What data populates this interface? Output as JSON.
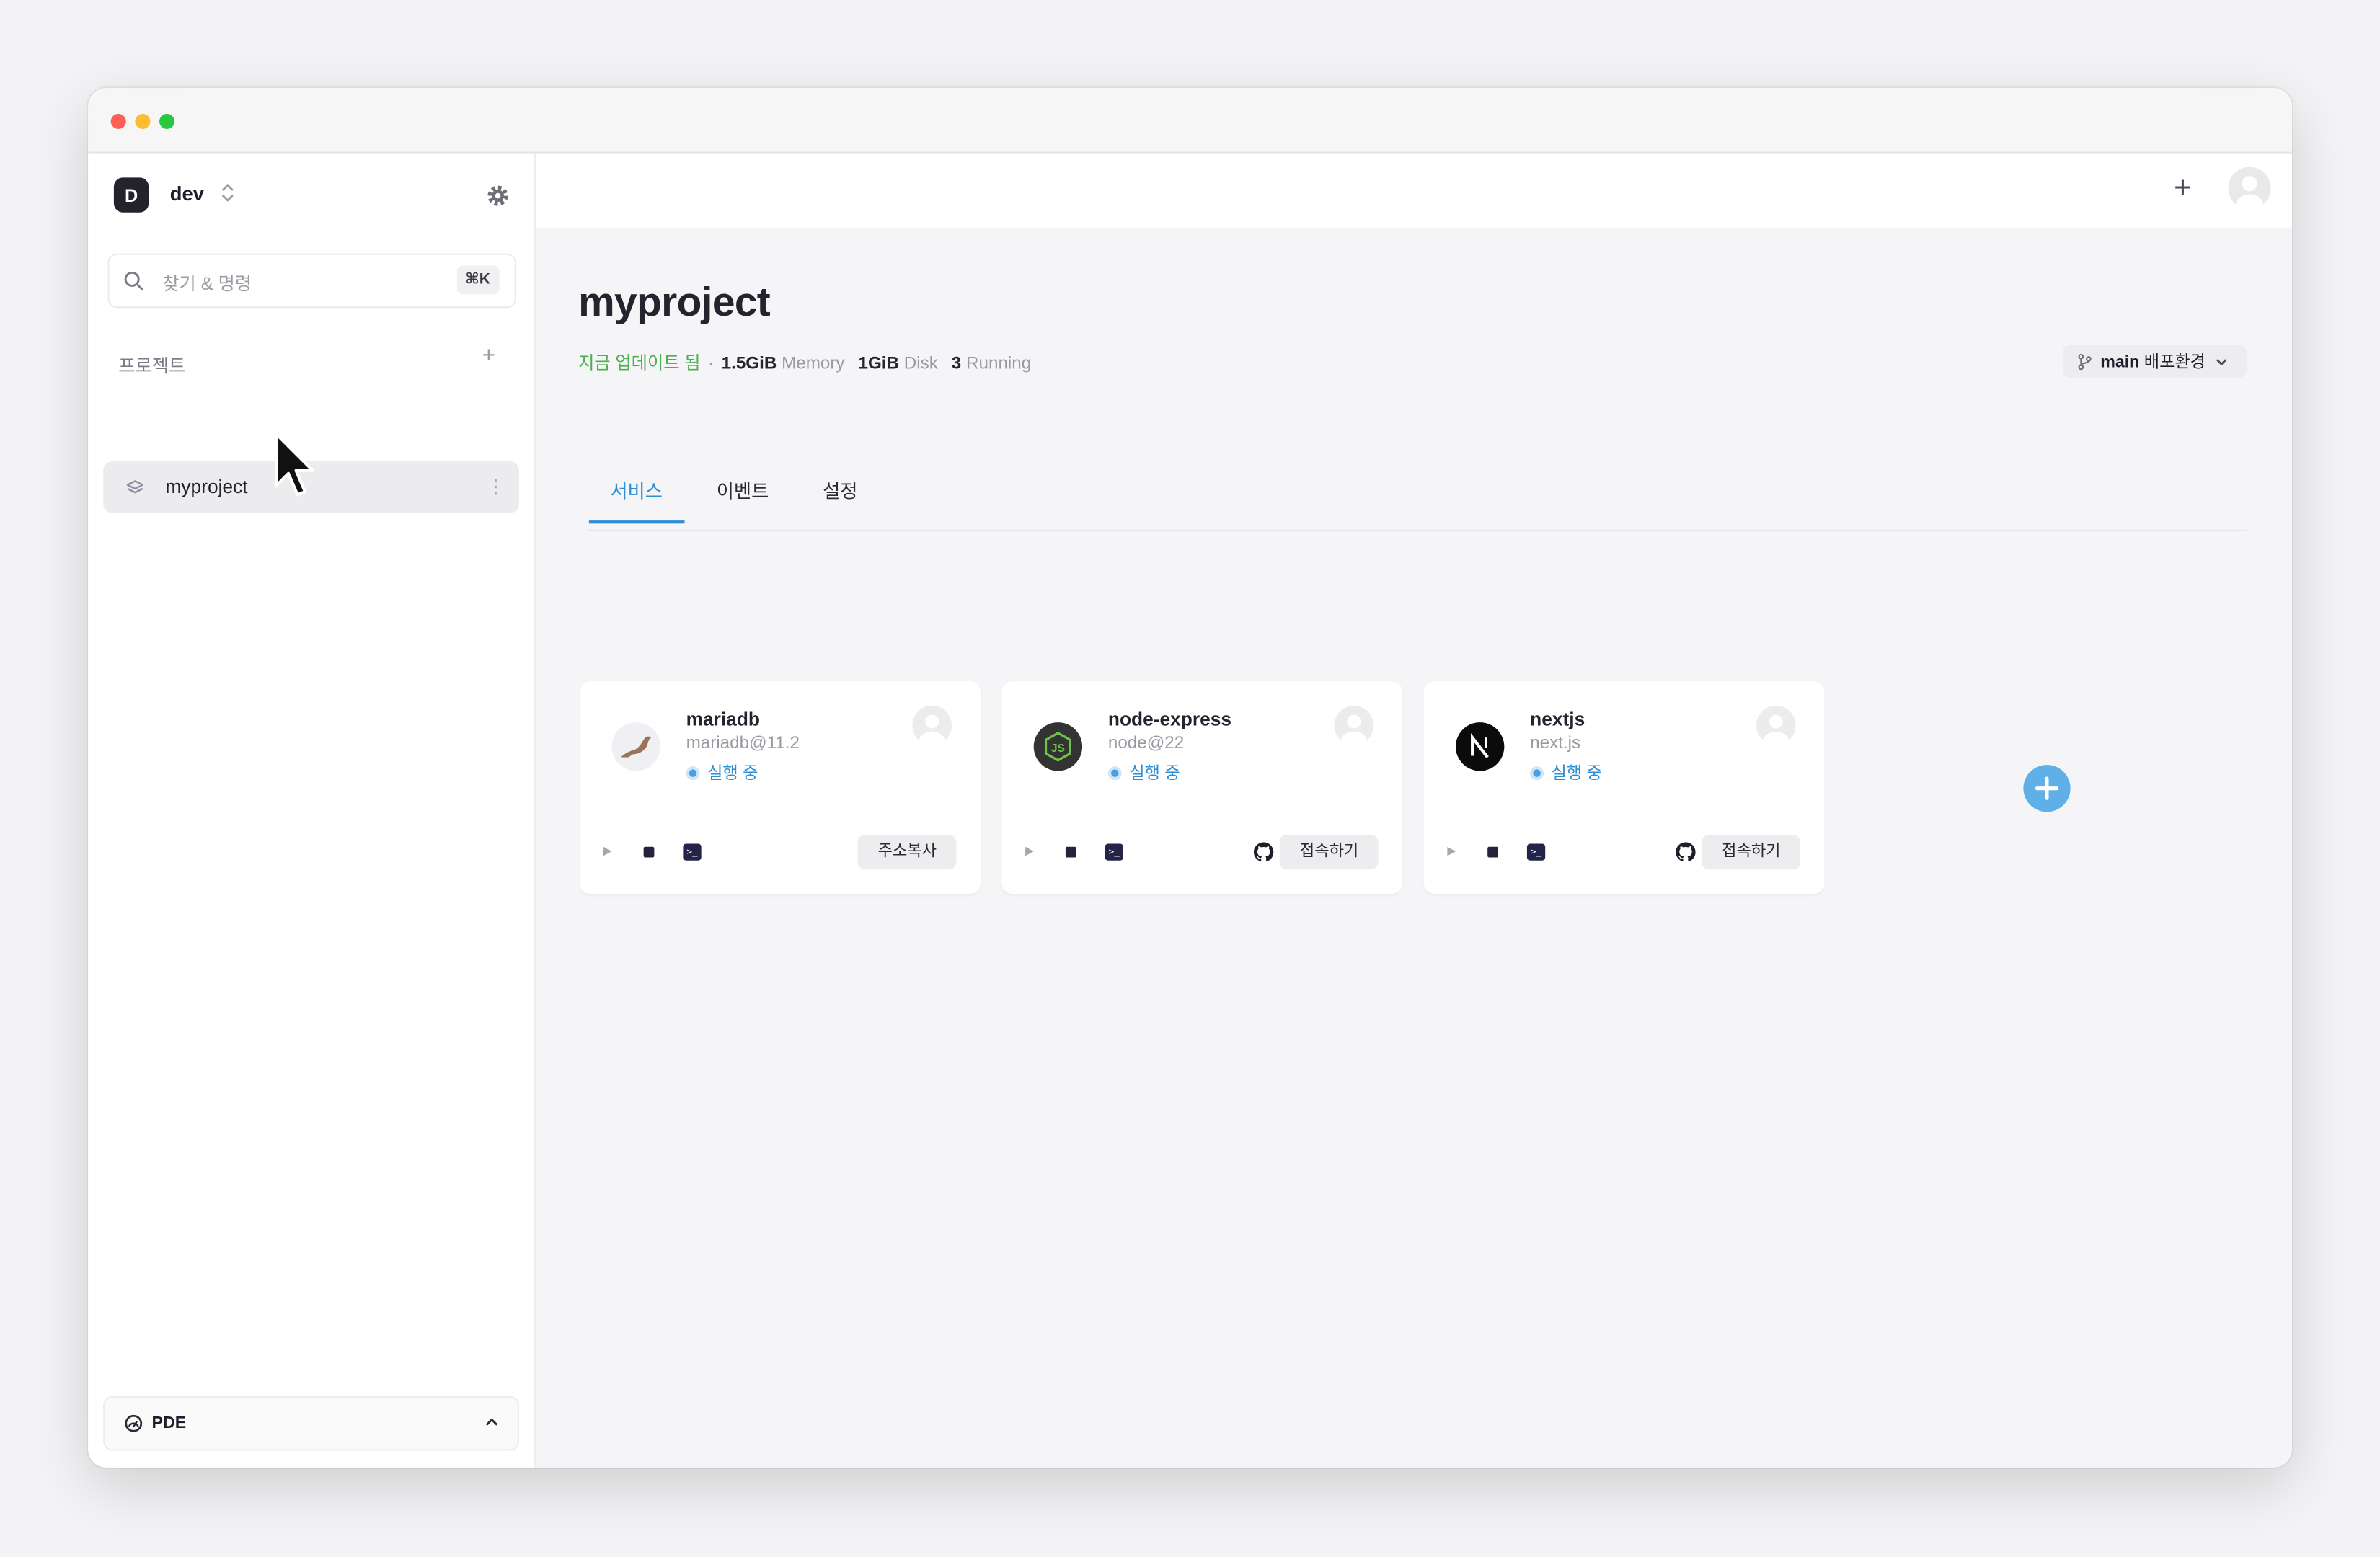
{
  "workspace": {
    "initial": "D",
    "name": "dev"
  },
  "search": {
    "placeholder": "찾기 & 명령",
    "shortcut": "⌘K"
  },
  "sidebar": {
    "section_label": "프로젝트",
    "projects": [
      {
        "label": "myproject"
      }
    ],
    "footer": {
      "label": "PDE"
    }
  },
  "project": {
    "title": "myproject",
    "updated": "지금 업데이트 됨",
    "separator": "·",
    "memory_value": "1.5GiB",
    "memory_unit": "Memory",
    "disk_value": "1GiB",
    "disk_unit": "Disk",
    "running_value": "3",
    "running_unit": "Running",
    "branch_name": "main",
    "branch_env": "배포환경"
  },
  "tabs": [
    {
      "label": "서비스"
    },
    {
      "label": "이벤트"
    },
    {
      "label": "설정"
    }
  ],
  "active_tab": "서비스",
  "services": [
    {
      "name": "mariadb",
      "version": "mariadb@11.2",
      "status": "실행 중",
      "action": "주소복사",
      "icon": "mariadb-seal-icon",
      "github": false
    },
    {
      "name": "node-express",
      "version": "node@22",
      "status": "실행 중",
      "action": "접속하기",
      "icon": "nodejs-icon",
      "github": true
    },
    {
      "name": "nextjs",
      "version": "next.js",
      "status": "실행 중",
      "action": "접속하기",
      "icon": "nextjs-icon",
      "github": true
    }
  ],
  "colors": {
    "accent": "#2c8fd6",
    "status_green": "#4caf50",
    "fab": "#5fb0e8"
  }
}
